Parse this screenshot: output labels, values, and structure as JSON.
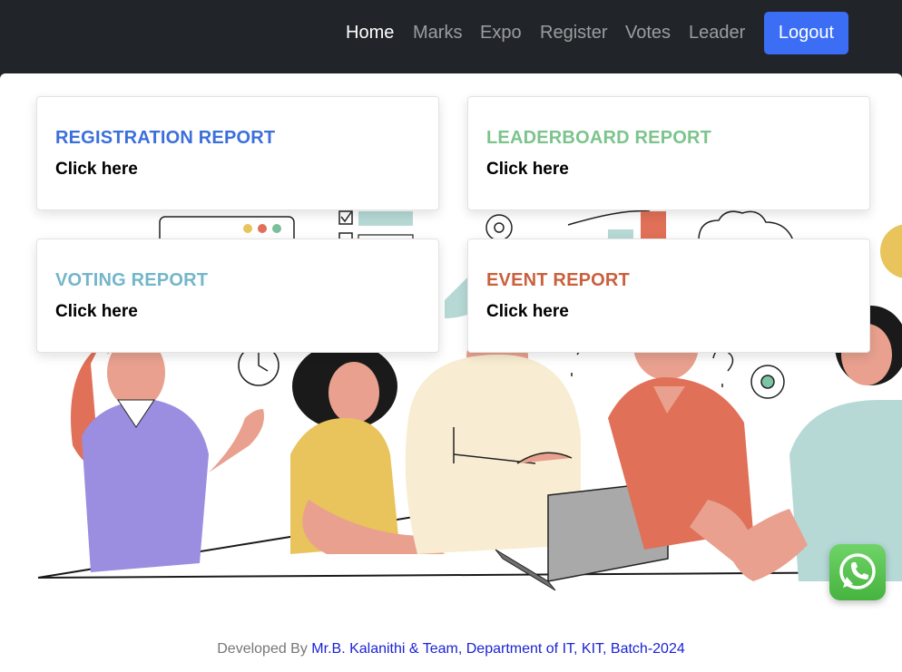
{
  "nav": {
    "links": [
      "Home",
      "Marks",
      "Expo",
      "Register",
      "Votes",
      "Leader"
    ],
    "logout_label": "Logout"
  },
  "cards": [
    {
      "title": "REGISTRATION REPORT",
      "link": "Click here",
      "color": "#3b6fdc"
    },
    {
      "title": "LEADERBOARD REPORT",
      "link": "Click here",
      "color": "#7cc48c"
    },
    {
      "title": "VOTING REPORT",
      "link": "Click here",
      "color": "#74b6c9"
    },
    {
      "title": "EVENT REPORT",
      "link": "Click here",
      "color": "#c9603e"
    }
  ],
  "footer": {
    "prefix": "Developed By ",
    "credit": "Mr.B. Kalanithi & Team, Department of IT, KIT, Batch-2024"
  },
  "colors": {
    "navbar": "#212529",
    "accent": "#3b6ef5"
  },
  "icons": {
    "whatsapp": "whatsapp-icon"
  }
}
